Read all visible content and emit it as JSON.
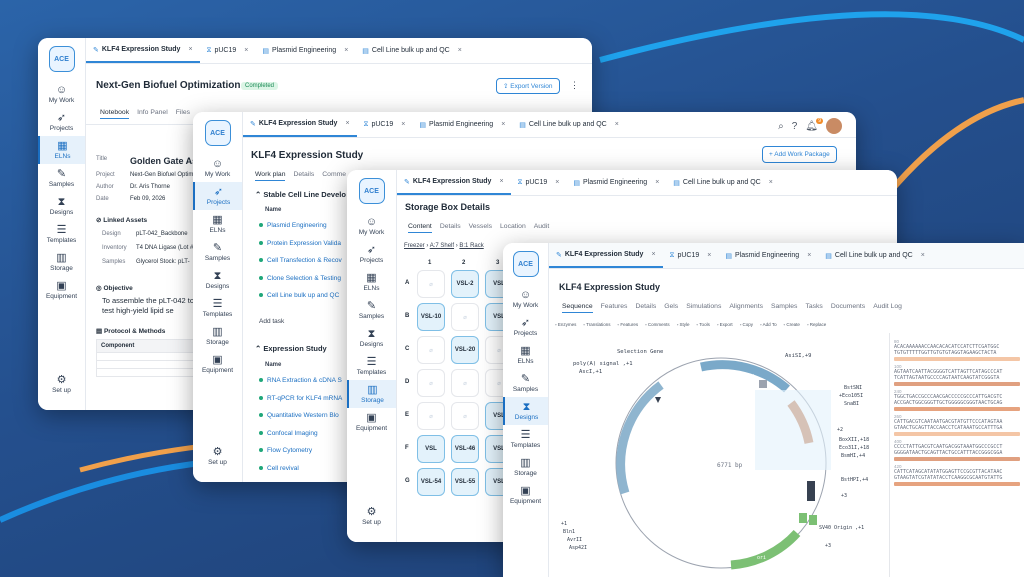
{
  "colors": {
    "accent": "#2f86d6",
    "orange": "#f0a04b",
    "background": "#244f8d"
  },
  "w1": {
    "logo": "ACE",
    "nav": [
      {
        "icon": "user-icon",
        "label": "My Work"
      },
      {
        "icon": "rocket-icon",
        "label": "Projects"
      },
      {
        "icon": "eln-icon",
        "label": "ELNs"
      },
      {
        "icon": "pipette-icon",
        "label": "Samples"
      },
      {
        "icon": "hourglass-icon",
        "label": "Designs"
      },
      {
        "icon": "templates-icon",
        "label": "Templates"
      },
      {
        "icon": "storage-icon",
        "label": "Storage"
      },
      {
        "icon": "equipment-icon",
        "label": "Equipment"
      }
    ],
    "setup": "Set up",
    "tabs": [
      "KLF4 Expression Study",
      "pUC19",
      "Plasmid Engineering",
      "Cell Line bulk up and QC"
    ],
    "title": "Next-Gen Biofuel Optimization",
    "badge": "Completed",
    "export": "Export Version",
    "subtabs": [
      "Notebook",
      "Info Panel",
      "Files"
    ],
    "fields": [
      {
        "k": "Title",
        "v": "Golden Gate As"
      },
      {
        "k": "Project",
        "v": "Next-Gen Biofuel Optimi"
      },
      {
        "k": "Author",
        "v": "Dr. Aris Thorne"
      },
      {
        "k": "Date",
        "v": "Feb 09, 2026"
      }
    ],
    "linked_title": "Linked Assets",
    "linked": [
      {
        "k": "Design",
        "v": "pLT-042_Backbone"
      },
      {
        "k": "Inventory",
        "v": "T4 DNA Ligase (Lot #"
      },
      {
        "k": "Samples",
        "v": "Glycerol Stock: pLT-"
      }
    ],
    "objective_title": "Objective",
    "objective": "To assemble the pLT-042 to test high-yield lipid se",
    "protocol_title": "Protocol & Methods",
    "component": "Component"
  },
  "w2": {
    "nav": [
      {
        "icon": "user-icon",
        "label": "My Work"
      },
      {
        "icon": "rocket-icon",
        "label": "Projects"
      },
      {
        "icon": "eln-icon",
        "label": "ELNs"
      },
      {
        "icon": "pipette-icon",
        "label": "Samples"
      },
      {
        "icon": "hourglass-icon",
        "label": "Designs"
      },
      {
        "icon": "templates-icon",
        "label": "Templates"
      },
      {
        "icon": "storage-icon",
        "label": "Storage"
      },
      {
        "icon": "equipment-icon",
        "label": "Equipment"
      }
    ],
    "setup": "Set up",
    "tabs": [
      "KLF4 Expression Study",
      "pUC19",
      "Plasmid Engineering",
      "Cell Line bulk up and QC"
    ],
    "title": "KLF4 Expression Study",
    "add": "+ Add Work Package",
    "subtabs": [
      "Work plan",
      "Details",
      "Comme"
    ],
    "group1": "Stable Cell Line Develo",
    "name_header": "Name",
    "g1_items": [
      "Plasmid Engineering",
      "Protein Expression Valida",
      "Cell Transfection & Recov",
      "Clone Selection & Testing",
      "Cell Line bulk up and QC"
    ],
    "add_task": "Add task",
    "group2": "Expression Study",
    "g2_items": [
      "RNA Extraction & cDNA S",
      "RT-qPCR for KLF4 mRNA",
      "Quantitative Western Blo",
      "Confocal Imaging",
      "Flow Cytometry",
      "Cell revival"
    ],
    "notif": "9"
  },
  "w3": {
    "nav": [
      {
        "icon": "user-icon",
        "label": "My Work"
      },
      {
        "icon": "rocket-icon",
        "label": "Projects"
      },
      {
        "icon": "eln-icon",
        "label": "ELNs"
      },
      {
        "icon": "pipette-icon",
        "label": "Samples"
      },
      {
        "icon": "hourglass-icon",
        "label": "Designs"
      },
      {
        "icon": "templates-icon",
        "label": "Templates"
      },
      {
        "icon": "storage-icon",
        "label": "Storage"
      },
      {
        "icon": "equipment-icon",
        "label": "Equipment"
      }
    ],
    "setup": "Set up",
    "tabs": [
      "KLF4 Expression Study",
      "pUC19",
      "Plasmid Engineering",
      "Cell Line bulk up and QC"
    ],
    "title": "Storage Box Details",
    "subtabs": [
      "Content",
      "Details",
      "Vessels",
      "Location",
      "Audit"
    ],
    "crumb": [
      "Freezer",
      "A:7 Shelf",
      "B:1 Rack"
    ],
    "cols": [
      "1",
      "2",
      "3"
    ],
    "rows": [
      "A",
      "B",
      "C",
      "D",
      "E",
      "F",
      "G"
    ],
    "cells": {
      "A2": "VSL-2",
      "A3": "VSL",
      "B1": "VSL-10",
      "B3": "VSL",
      "C2": "VSL-20",
      "E3": "VSL",
      "F1": "VSL",
      "F2": "VSL-46",
      "F3": "VSL",
      "G1": "VSL-54",
      "G2": "VSL-55",
      "G3": "VSL"
    }
  },
  "w4": {
    "nav": [
      {
        "icon": "user-icon",
        "label": "My Work"
      },
      {
        "icon": "rocket-icon",
        "label": "Projects"
      },
      {
        "icon": "eln-icon",
        "label": "ELNs"
      },
      {
        "icon": "pipette-icon",
        "label": "Samples"
      },
      {
        "icon": "hourglass-icon",
        "label": "Designs"
      },
      {
        "icon": "templates-icon",
        "label": "Templates"
      },
      {
        "icon": "storage-icon",
        "label": "Storage"
      },
      {
        "icon": "equipment-icon",
        "label": "Equipment"
      }
    ],
    "tabs": [
      "KLF4 Expression Study",
      "pUC19",
      "Plasmid Engineering",
      "Cell Line bulk up and QC"
    ],
    "title": "KLF4 Expression Study",
    "subtabs": [
      "Sequence",
      "Features",
      "Details",
      "Gels",
      "Simulations",
      "Alignments",
      "Samples",
      "Tasks",
      "Documents",
      "Audit Log"
    ],
    "toolbar": [
      "Enzymes",
      "Translations",
      "Features",
      "Comments",
      "Style",
      "Tools",
      "Export",
      "Copy",
      "Add To",
      "Create",
      "Replace"
    ],
    "map_center": "6771 bp",
    "map_labels": {
      "selection": "Selection Gene",
      "polya": "poly(A) signal ,+1",
      "ascl": "AscI,+1",
      "kan": "Kanamycin (KanR)",
      "ascii": "AsiSI,+9",
      "bstsnI": "BstSNI",
      "eco105I": "+Eco105I",
      "snabI": "SnaBI",
      "c2": "+2",
      "boxii": "BoxXII,+18",
      "eco31": "Eco31I,+18",
      "bsmhl": "BsmHI,+4",
      "bsthpi": "BstHPI,+4",
      "sv40": "SV40 Origin ,+1",
      "p3": "+3",
      "hrs": "Hrs",
      "ori": "ori",
      "bin1": "Bln1",
      "avr": "AvrII",
      "asp": "Asp42I",
      "plus1": "+1"
    },
    "seq_numbers": [
      "80",
      "100",
      "240",
      "260",
      "400",
      "420",
      "480",
      "500"
    ],
    "seq_lines": [
      "ACACAAAAAACCAACACACATCCATCTTCGATGGC",
      "TGTGTTTTTGGTTGTGTGTAGGTAGAAGCTACTA",
      "AGTAATCAATTACGGGGTCATTAGTTCATAGCCCAT",
      "TCATTAGTAATGCCCCAGTAATCAAGTATCGGGTA",
      "TGGCTGACCGCCCAACGACCCCCGCCCATTGACGTC",
      "ACCGACTGGCGGGTTGCTGGGGGCGGGTAACTGCAG",
      "CATTGACGTCAATAATGACGTATGTTCCCATAGTAA",
      "GTAACTGCAGTTACCAACCTCATAAATGCCATTTGA",
      "CCCCTATTGACGTCAATGACGGTAAATGGCCCGCCT",
      "GGGGATAACTGCAGTTACTGCCATTTACCGGGCGGA",
      "CATTCATAGCATATATGGAGTTCCGCGTTACATAAC",
      "GTAAGTATCGTATATACCTCAAGGCGCAATGTATTG"
    ]
  }
}
